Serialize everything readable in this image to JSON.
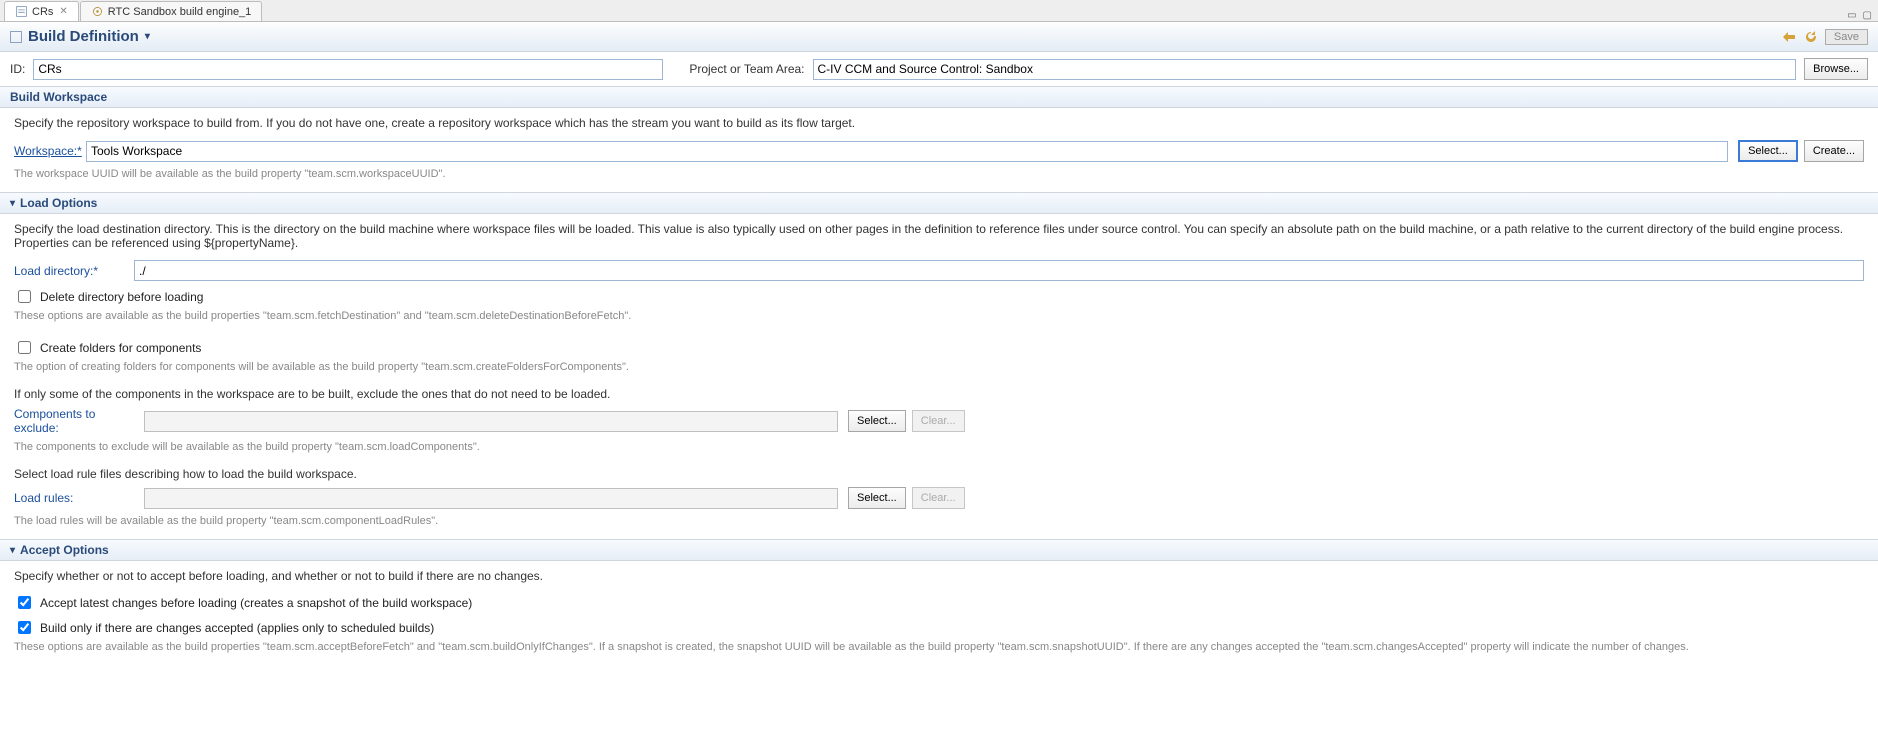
{
  "tabs": {
    "t0": {
      "label": "CRs"
    },
    "t1": {
      "label": "RTC Sandbox build engine_1"
    }
  },
  "header": {
    "title": "Build Definition",
    "save_label": "Save"
  },
  "idrow": {
    "id_label": "ID:",
    "id_value": "CRs",
    "team_label": "Project or Team Area:",
    "team_value": "C-IV CCM and Source Control: Sandbox",
    "browse_label": "Browse..."
  },
  "workspace": {
    "title": "Build Workspace",
    "desc": "Specify the repository workspace to build from. If you do not have one, create a repository workspace which has the stream you want to build as its flow target.",
    "label": "Workspace:",
    "value": "Tools Workspace",
    "select_label": "Select...",
    "create_label": "Create...",
    "hint": "The workspace UUID will be available as the build property \"team.scm.workspaceUUID\"."
  },
  "load": {
    "title": "Load Options",
    "desc": "Specify the load destination directory. This is the directory on the build machine where workspace files will be loaded. This value is also typically used on other pages in the definition to reference files under source control. You can specify an absolute path on the build machine, or a path relative to the current directory of the build engine process. Properties can be referenced using ${propertyName}.",
    "dir_label": "Load directory:",
    "dir_value": "./",
    "delete_label": "Delete directory before loading",
    "delete_hint": "These options are available as the build properties \"team.scm.fetchDestination\" and \"team.scm.deleteDestinationBeforeFetch\".",
    "folders_label": "Create folders for components",
    "folders_hint": "The option of creating folders for components will be available as the build property \"team.scm.createFoldersForComponents\".",
    "exclude_desc": "If only some of the components in the workspace are to be built, exclude the ones that do not need to be loaded.",
    "exclude_label": "Components to exclude:",
    "select_label": "Select...",
    "clear_label": "Clear...",
    "exclude_hint": "The components to exclude will be available as the build property \"team.scm.loadComponents\".",
    "rules_desc": "Select load rule files describing how to load the build workspace.",
    "rules_label": "Load rules:",
    "rules_hint": "The load rules will be available as the build property \"team.scm.componentLoadRules\"."
  },
  "accept": {
    "title": "Accept Options",
    "desc": "Specify whether or not to accept before loading, and whether or not to build if there are no changes.",
    "cb1_label": "Accept latest changes before loading (creates a snapshot of the build workspace)",
    "cb2_label": "Build only if there are changes accepted (applies only to scheduled builds)",
    "hint": "These options are available as the build properties \"team.scm.acceptBeforeFetch\" and \"team.scm.buildOnlyIfChanges\". If a snapshot is created, the snapshot UUID will be available as the build property \"team.scm.snapshotUUID\". If there are any changes accepted the \"team.scm.changesAccepted\" property will indicate the number of changes."
  }
}
